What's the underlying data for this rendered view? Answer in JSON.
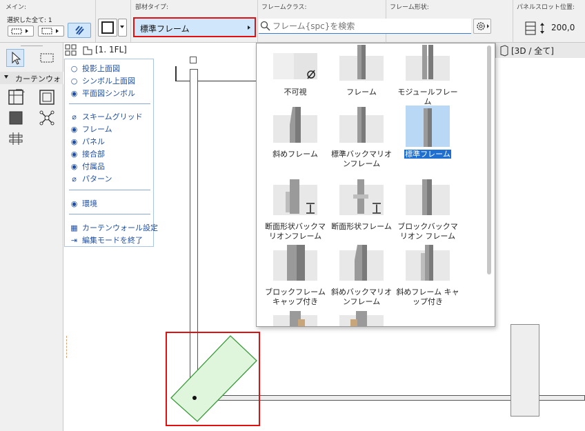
{
  "infobar": {
    "main_label": "メイン:",
    "selected_count": "選択した全て: 1",
    "member_type_label": "部材タイプ:",
    "member_type_value": "標準フレーム",
    "frame_class_label": "フレームクラス:",
    "frame_shape_label": "フレーム形状:",
    "panel_slot_label": "パネルスロット位置:",
    "panel_slot_value": "200,0"
  },
  "search": {
    "placeholder": "フレーム{spc}を検索"
  },
  "toolbox": {
    "section_label": "カーテンウォー."
  },
  "view": {
    "floor_tab": "[1. 1FL]",
    "tab_3d": "[3D / 全て]"
  },
  "display_panel": {
    "radio_items": [
      "投影上面図",
      "シンボル上面図",
      "平面図シンボル"
    ],
    "radio_selected": 2,
    "items": [
      "スキームグリッド",
      "フレーム",
      "パネル",
      "接合部",
      "付属品",
      "パターン"
    ],
    "env_item": "環境",
    "settings_item": "カーテンウォール設定",
    "exit_item": "編集モードを終了"
  },
  "frame_types": [
    "不可視",
    "フレーム",
    "モジュールフレーム",
    "斜めフレーム",
    "標準バックマリオンフレーム",
    "標準フレーム",
    "断面形状バックマリオンフレーム",
    "断面形状フレーム",
    "ブロックバックマリオン フレーム",
    "ブロックフレーム キャップ付き",
    "斜めバックマリオンフレーム",
    "斜めフレーム キャップ付き"
  ],
  "colors": {
    "accent": "#1f6fd1",
    "highlight": "#e01010",
    "link": "#1f4fa3",
    "selection_fill": "#cfe6fb"
  }
}
